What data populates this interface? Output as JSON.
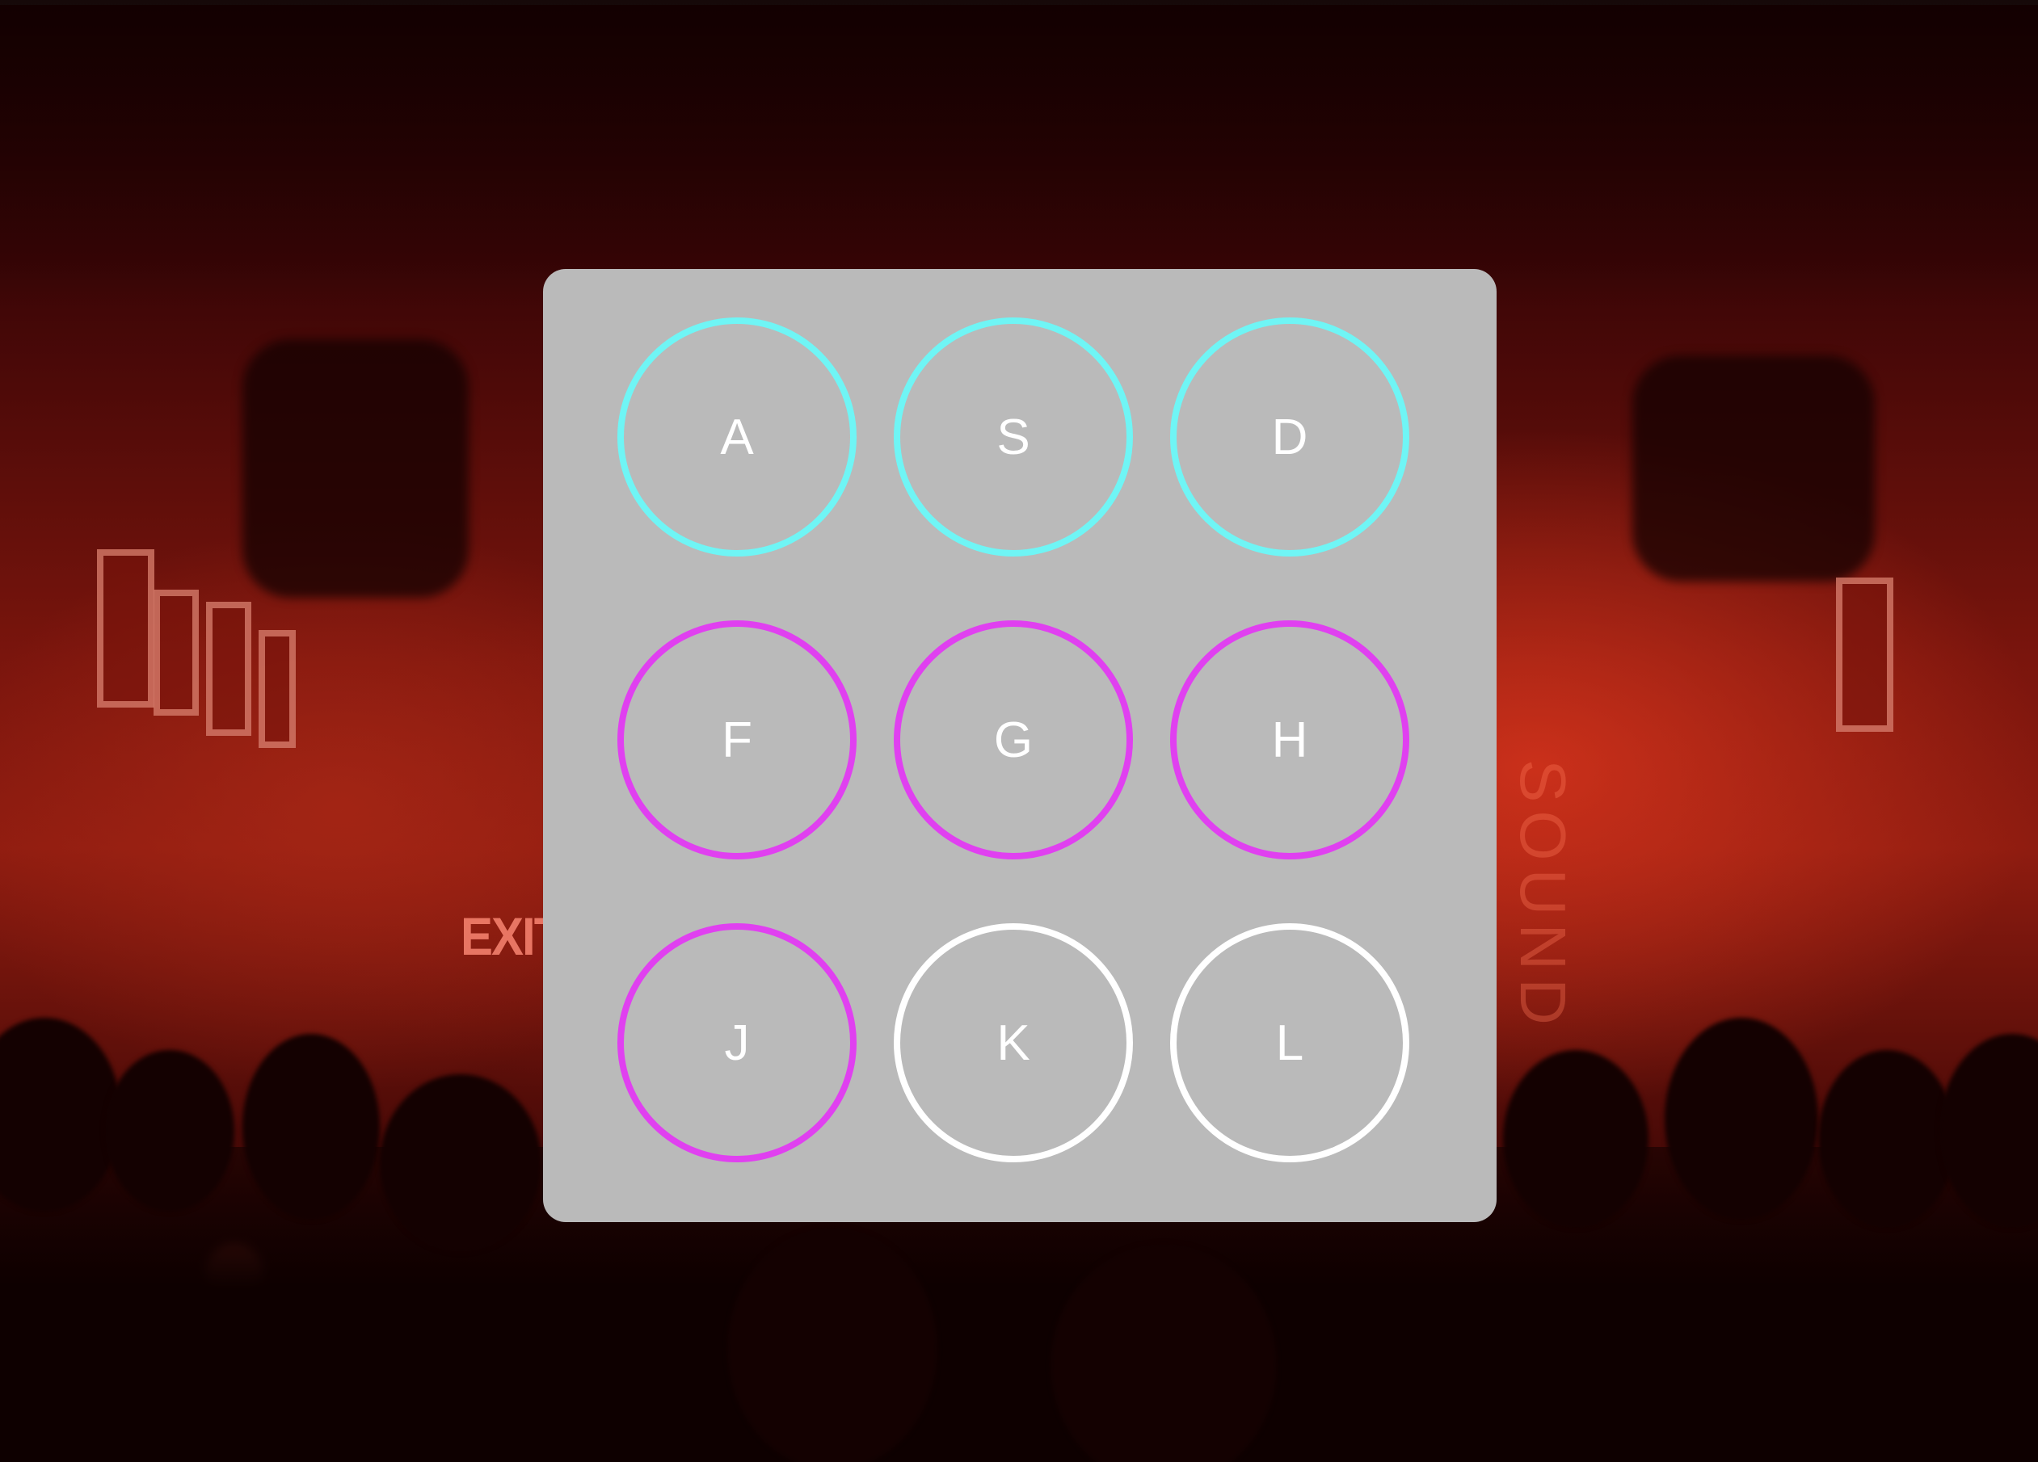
{
  "background": {
    "description_icon": "concert-crowd-background",
    "exit_sign": "EXIT",
    "stage_sign": "SOUND"
  },
  "drum_pads": {
    "colors": {
      "cyan": "#6ff5f5",
      "magenta": "#e040f0",
      "white": "#ffffff"
    },
    "pads": [
      {
        "key": "A",
        "color": "#6ff5f5"
      },
      {
        "key": "S",
        "color": "#6ff5f5"
      },
      {
        "key": "D",
        "color": "#6ff5f5"
      },
      {
        "key": "F",
        "color": "#e040f0"
      },
      {
        "key": "G",
        "color": "#e040f0"
      },
      {
        "key": "H",
        "color": "#e040f0"
      },
      {
        "key": "J",
        "color": "#e040f0"
      },
      {
        "key": "K",
        "color": "#ffffff"
      },
      {
        "key": "L",
        "color": "#ffffff"
      }
    ]
  }
}
